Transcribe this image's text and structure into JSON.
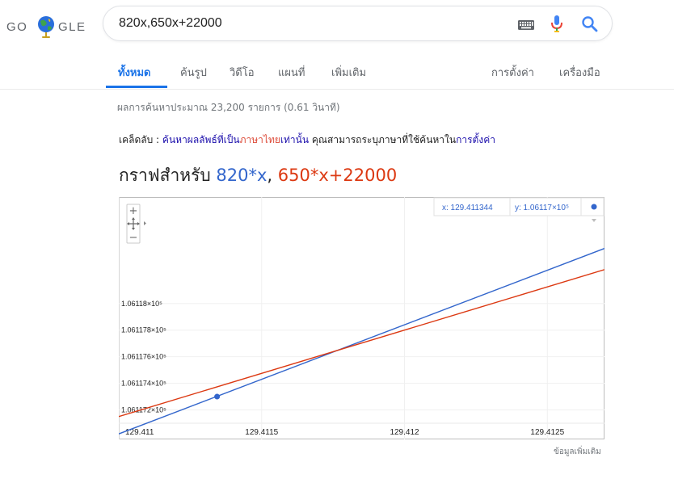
{
  "logo": {
    "left": "GO",
    "right": "GLE"
  },
  "search": {
    "value": "820x,650x+22000"
  },
  "tabs": [
    "ทั้งหมด",
    "ค้นรูป",
    "วิดีโอ",
    "แผนที่",
    "เพิ่มเติม",
    "การตั้งค่า",
    "เครื่องมือ"
  ],
  "stats": "ผลการค้นหาประมาณ 23,200 รายการ (0.61 วินาที)",
  "tip": {
    "prefix": "เคล็ดลับ : ",
    "link1": "ค้นหาผลลัพธ์ที่เป็น",
    "link2": "ภาษาไทย",
    "link3": "เท่านั้น",
    "middle": " คุณสามารถระบุภาษาที่ใช้ค้นหาใน",
    "link4": "การตั้งค่า"
  },
  "graph_title": {
    "prefix": "กราฟสำหรับ ",
    "f1": "820*x",
    "sep": ", ",
    "f2": "650*x+22000"
  },
  "readout": {
    "x": "x: 129.411344",
    "y": "y: 1.06117×10⁵"
  },
  "zoom": {
    "plus": "+",
    "minus": "−"
  },
  "more_info": "ข้อมูลเพิ่มเติม",
  "colors": {
    "accent": "#1a73e8",
    "series1": "#3366cc",
    "series2": "#dc3912",
    "link": "#1a0dab"
  },
  "chart_data": {
    "type": "line",
    "xlim": [
      129.411,
      129.4127
    ],
    "ylim": [
      106117.1,
      106118.8
    ],
    "x_ticks": [
      129.411,
      129.4115,
      129.412,
      129.4125
    ],
    "x_tick_labels": [
      "129.411",
      "129.4115",
      "129.412",
      "129.4125"
    ],
    "y_ticks": [
      106117.2,
      106117.4,
      106117.6,
      106117.8,
      106118.0
    ],
    "y_tick_labels": [
      "1.061172×10⁵",
      "1.061174×10⁵",
      "1.061176×10⁵",
      "1.061178×10⁵",
      "1.06118×10⁵"
    ],
    "series": [
      {
        "formula": "820*x",
        "slope": 820,
        "intercept": 0,
        "color": "#3366cc"
      },
      {
        "formula": "650*x+22000",
        "slope": 650,
        "intercept": 22000,
        "color": "#dc3912"
      }
    ],
    "marker": {
      "x": 129.411344,
      "y": 106117.3
    }
  }
}
